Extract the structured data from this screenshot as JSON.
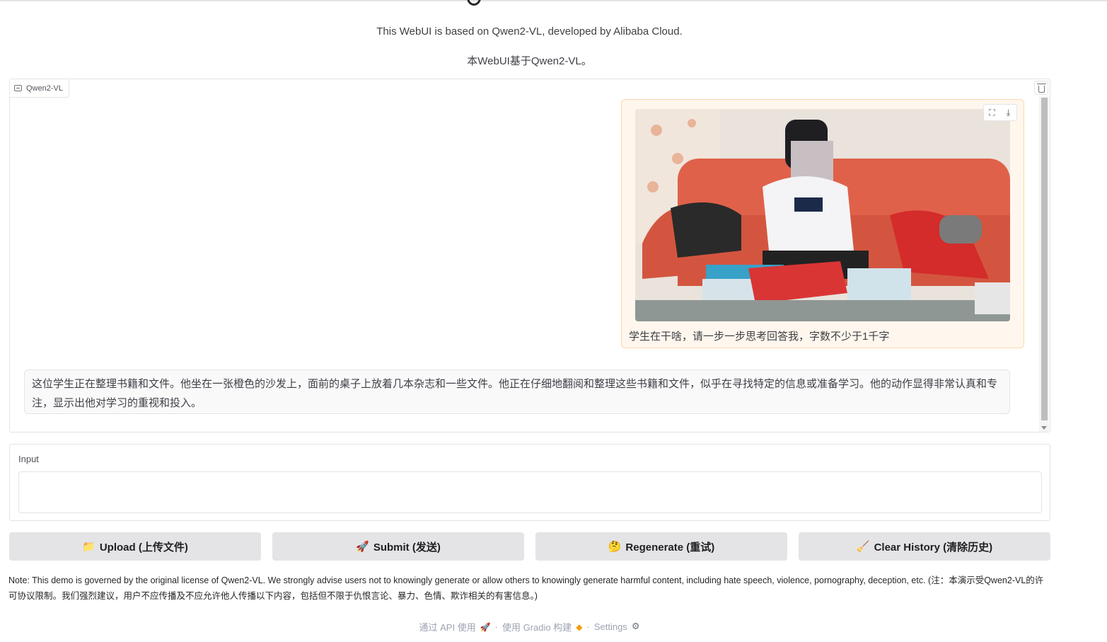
{
  "header": {
    "subtitle_en": "This WebUI is based on Qwen2-VL, developed by Alibaba Cloud.",
    "subtitle_zh": "本WebUI基于Qwen2-VL。"
  },
  "chatbot": {
    "label": "Qwen2-VL",
    "user_message": "学生在干啥，请一步一步思考回答我，字数不少于1千字",
    "user_image_alt": "boy-sitting-on-orange-sofa-with-books",
    "bot_message": "这位学生正在整理书籍和文件。他坐在一张橙色的沙发上，面前的桌子上放着几本杂志和一些文件。他正在仔细地翻阅和整理这些书籍和文件，似乎在寻找特定的信息或准备学习。他的动作显得非常认真和专注，显示出他对学习的重视和投入。"
  },
  "input": {
    "label": "Input",
    "value": ""
  },
  "buttons": {
    "upload": "Upload (上传文件)",
    "submit": "Submit (发送)",
    "regenerate": "Regenerate (重试)",
    "clear": "Clear History (清除历史)"
  },
  "icons": {
    "upload": "folder-icon",
    "submit": "rocket-icon",
    "regenerate": "thinking-face-icon",
    "clear": "broom-icon"
  },
  "note": "Note: This demo is governed by the original license of Qwen2-VL. We strongly advise users not to knowingly generate or allow others to knowingly generate harmful content, including hate speech, violence, pornography, deception, etc. (注：本演示受Qwen2-VL的许可协议限制。我们强烈建议，用户不应传播及不应允许他人传播以下内容，包括但不限于仇恨言论、暴力、色情、欺诈相关的有害信息。)",
  "footer": {
    "api": "通过 API 使用",
    "gradio": "使用 Gradio 构建",
    "settings": "Settings",
    "separator": "·"
  },
  "colors": {
    "user_bubble_bg": "#fff7ed",
    "user_bubble_border": "#fed7aa",
    "button_bg": "#e4e4e7",
    "bot_bubble_bg": "#f9f9fa"
  }
}
